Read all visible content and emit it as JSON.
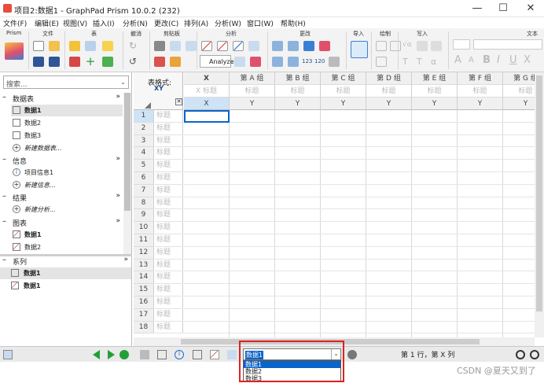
{
  "window": {
    "title": "项目2:数据1 - GraphPad Prism 10.0.2 (232)",
    "minimize": "—",
    "maximize": "☐",
    "close": "✕"
  },
  "menu": [
    "文件(F)",
    "编辑(E)",
    "视图(V)",
    "插入(I)",
    "分析(N)",
    "更改(C)",
    "排列(A)",
    "分析(W)",
    "窗口(W)",
    "帮助(H)"
  ],
  "ribbon": {
    "groups": [
      "Prism",
      "文件",
      "表",
      "撤消",
      "剪贴板",
      "分析",
      "更改",
      "导入",
      "绘制",
      "写入",
      "文本"
    ],
    "analyze_label": "Analyze",
    "text_font_a": "A",
    "text_font_b": "B",
    "text_font_i": "I",
    "text_font_u": "U",
    "text_font_x": "X"
  },
  "nav": {
    "search_placeholder": "搜索...",
    "sections": [
      {
        "label": "数据表",
        "items": [
          {
            "label": "数据1",
            "selected": true
          },
          {
            "label": "数据2"
          },
          {
            "label": "数据3"
          },
          {
            "label": "新建数据表..."
          }
        ]
      },
      {
        "label": "信息",
        "items": [
          {
            "label": "项目信息1"
          },
          {
            "label": "新建信息..."
          }
        ]
      },
      {
        "label": "结果",
        "items": [
          {
            "label": "新建分析..."
          }
        ]
      },
      {
        "label": "图表",
        "items": [
          {
            "label": "数据1"
          },
          {
            "label": "数据2"
          }
        ]
      }
    ],
    "series": {
      "label": "系列",
      "items": [
        {
          "label": "数据1",
          "selected": true
        },
        {
          "label": "数据1"
        }
      ]
    }
  },
  "grid": {
    "format_label": "表格式:",
    "format_value": "XY",
    "columns": [
      {
        "header": "X",
        "sub": "X 标题",
        "kind": "X"
      },
      {
        "header": "第 A 组",
        "sub": "标题",
        "kind": "Y"
      },
      {
        "header": "第 B 组",
        "sub": "标题",
        "kind": "Y"
      },
      {
        "header": "第 C 组",
        "sub": "标题",
        "kind": "Y"
      },
      {
        "header": "第 D 组",
        "sub": "标题",
        "kind": "Y"
      },
      {
        "header": "第 E 组",
        "sub": "标题",
        "kind": "Y"
      },
      {
        "header": "第 F 组",
        "sub": "标题",
        "kind": "Y"
      },
      {
        "header": "第 G 组",
        "sub": "标题",
        "kind": "Y"
      }
    ],
    "row_label": "标题",
    "rows": [
      "1",
      "2",
      "3",
      "4",
      "5",
      "6",
      "7",
      "8",
      "9",
      "10",
      "11",
      "12",
      "13",
      "14",
      "15",
      "16",
      "17",
      "18"
    ]
  },
  "status": {
    "combo_value": "数据1",
    "options": [
      "数据1",
      "数据2",
      "数据3"
    ],
    "cell_info": "第 1 行，第 X 列"
  },
  "watermark": "CSDN @夏天又到了",
  "colors": {
    "accent": "#0a64c9",
    "highlight_box": "#e02020",
    "selected_header": "#cfe3f7"
  }
}
